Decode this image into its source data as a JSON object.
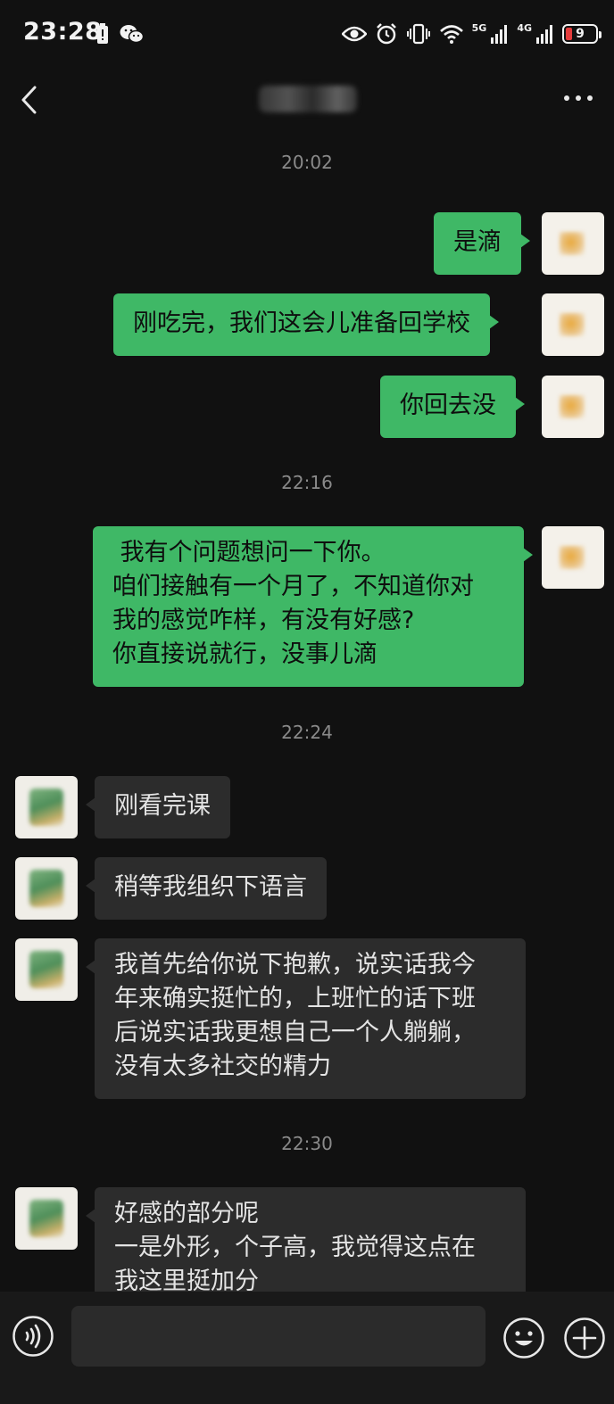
{
  "status_bar": {
    "time": "23:28",
    "net1": "5G",
    "net2": "4G",
    "battery": "9",
    "icons": [
      "battery-saver-icon",
      "wechat-icon",
      "eye-icon",
      "alarm-icon",
      "vibrate-icon",
      "wifi-icon",
      "signal-icon",
      "signal-icon",
      "battery-icon"
    ]
  },
  "nav": {
    "icons": [
      "back-arrow-icon",
      "more-dots-icon"
    ]
  },
  "messages": {
    "ts1": "20:02",
    "m1": "是滴",
    "m2": "刚吃完，我们这会儿准备回学校",
    "m3": "你回去没",
    "ts2": "22:16",
    "m4": [
      " 我有个问题想问一下你。",
      "咱们接触有一个月了，不知道你对",
      "我的感觉咋样，有没有好感?",
      "你直接说就行，没事儿滴"
    ],
    "ts3": "22:24",
    "r1": "刚看完课",
    "r2": "稍等我组织下语言",
    "r3": [
      "我首先给你说下抱歉，说实话我今",
      "年来确实挺忙的，上班忙的话下班",
      "后说实话我更想自己一个人躺躺，",
      "没有太多社交的精力"
    ],
    "ts4": "22:30",
    "r4": [
      "好感的部分呢",
      "一是外形，个子高，我觉得这点在",
      "我这里挺加分"
    ]
  },
  "input_bar": {
    "placeholder": "",
    "icons": [
      "voice-icon",
      "emoji-icon",
      "plus-icon"
    ]
  },
  "colors": {
    "background": "#111111",
    "my_bubble": "#3fb866",
    "their_bubble": "#2c2c2c",
    "timestamp": "#8a8a8a"
  }
}
